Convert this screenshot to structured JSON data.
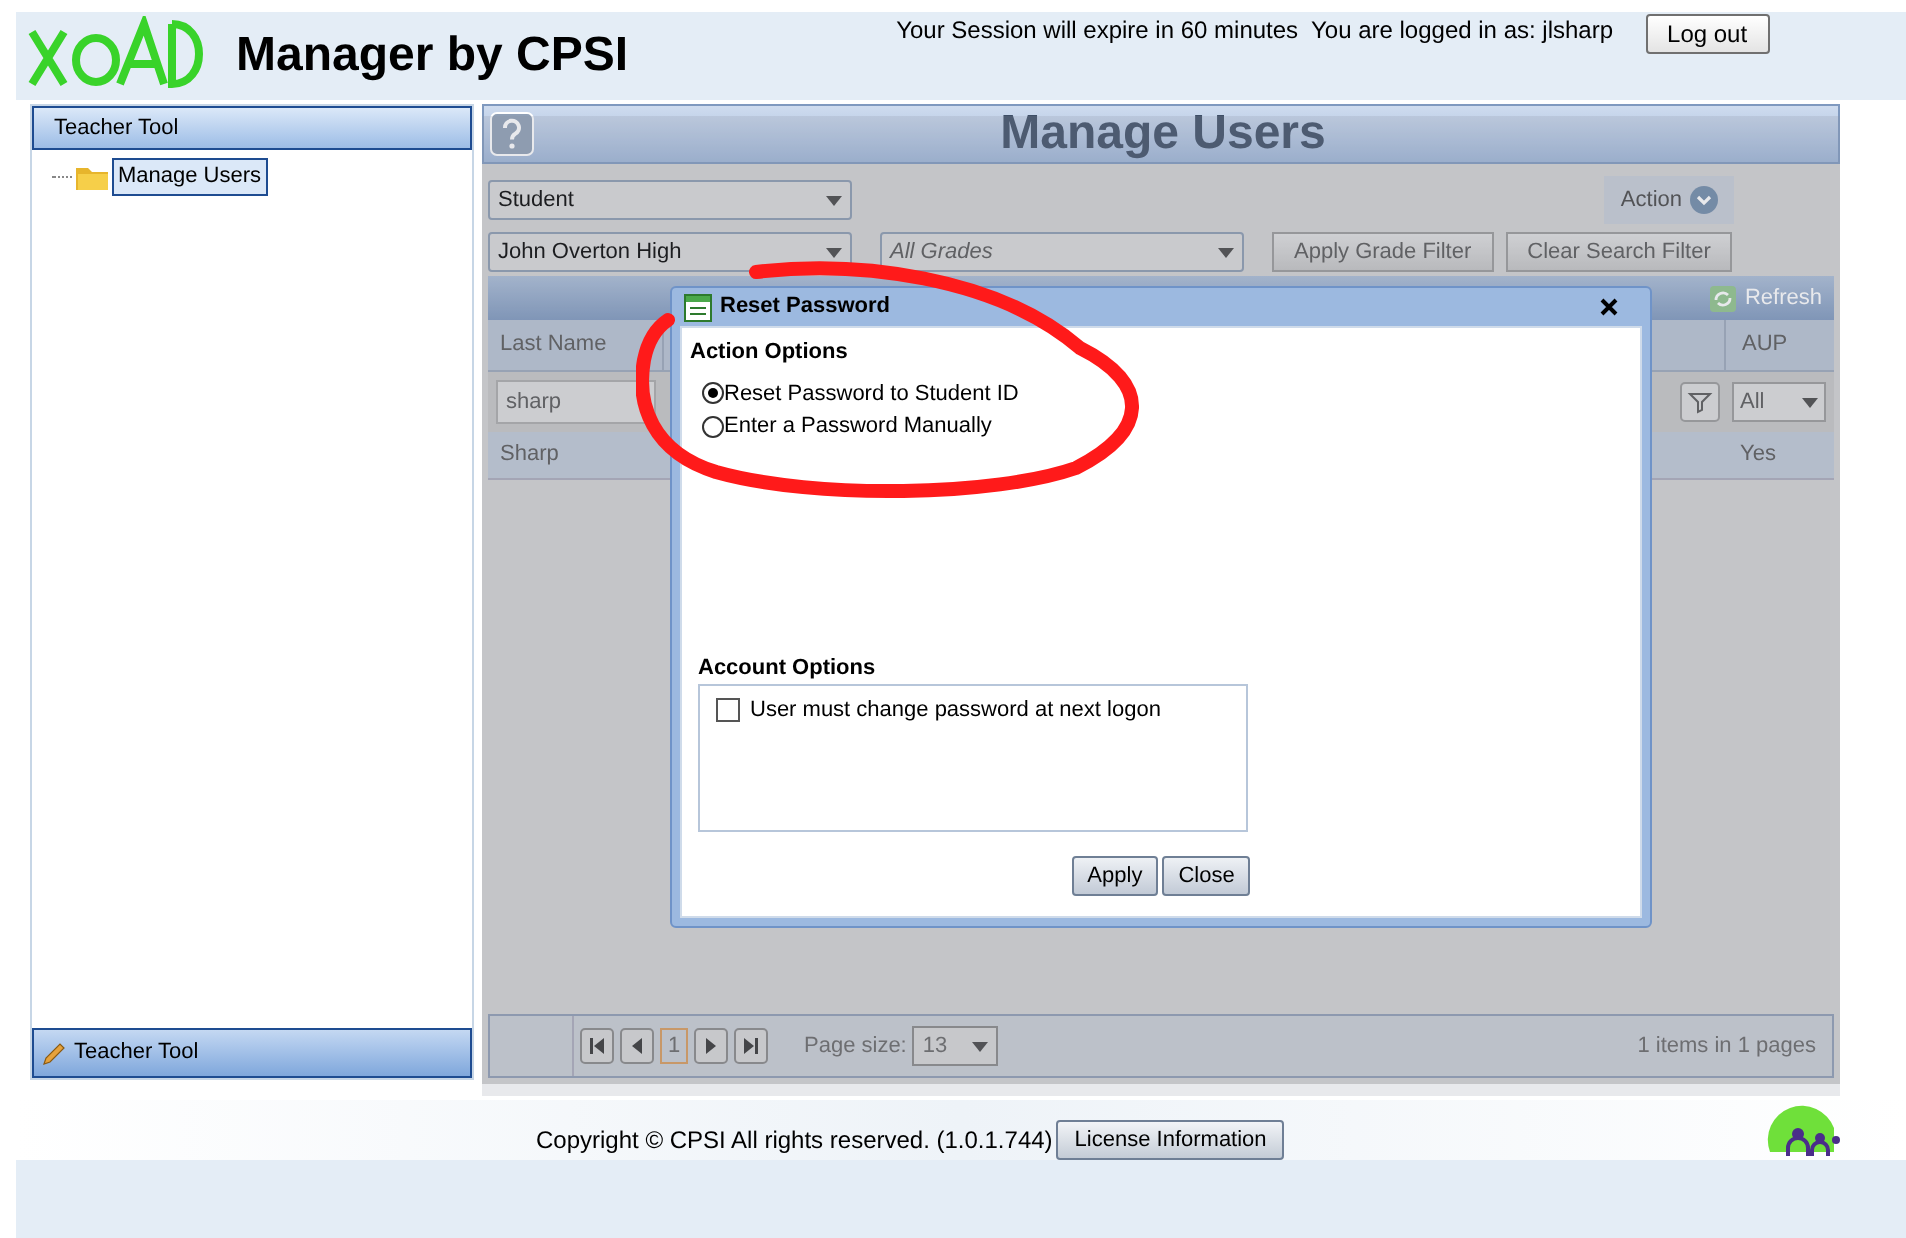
{
  "header": {
    "title": "Manager by CPSI",
    "session_text": "Your Session will expire in 60 minutes  You are logged in as: jlsharp",
    "logout": "Log out"
  },
  "sidebar": {
    "title": "Teacher Tool",
    "items": [
      {
        "label": "Manage Users",
        "selected": true
      }
    ],
    "bottom_title": "Teacher Tool"
  },
  "main": {
    "title": "Manage Users",
    "role_select": "Student",
    "action": "Action",
    "school_select": "John Overton High",
    "grade_select": {
      "placeholder": "All Grades"
    },
    "filter_buttons": [
      "Apply Grade Filter",
      "Clear Search Filter"
    ],
    "refresh": "Refresh",
    "columns": [
      {
        "label": "Last Name",
        "filter": "sharp"
      },
      {
        "label": "AUP",
        "filter": "All"
      }
    ],
    "rows": [
      [
        "Sharp",
        "Yes"
      ]
    ],
    "pager": {
      "page": "1",
      "page_size_label": "Page size:",
      "page_size": "13",
      "summary": "1 items in 1 pages"
    }
  },
  "dialog": {
    "title": "Reset Password",
    "action_title": "Action Options",
    "options": [
      {
        "label": "Reset Password to Student ID",
        "selected": true
      },
      {
        "label": "Enter a Password Manually",
        "selected": false
      }
    ],
    "account_title": "Account Options",
    "checkbox": {
      "label": "User must change password at next logon",
      "checked": false
    },
    "buttons": [
      "Apply",
      "Close"
    ]
  },
  "footer": {
    "copyright": "Copyright © CPSI All rights reserved. (1.0.1.744)",
    "license": "License Information"
  }
}
